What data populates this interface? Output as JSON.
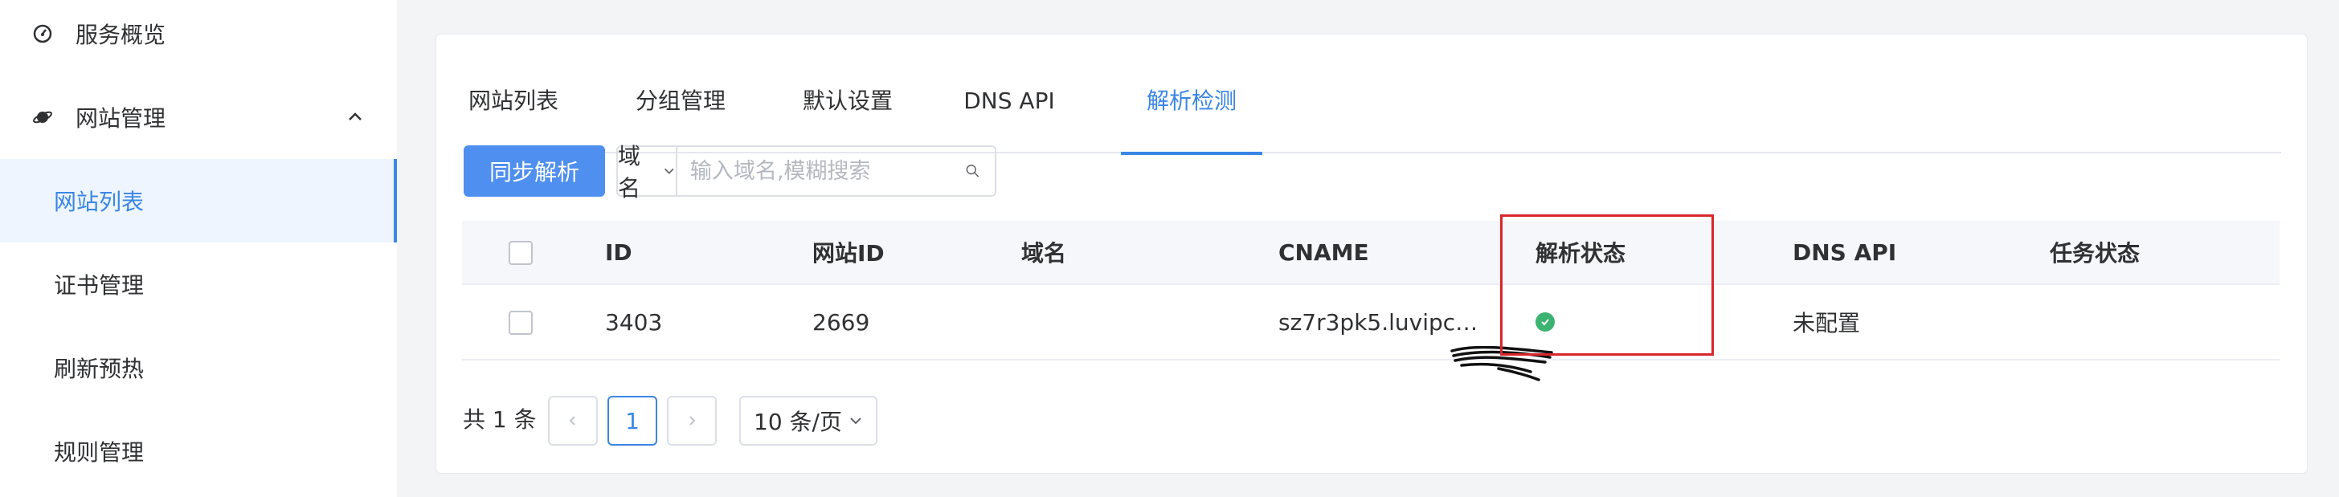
{
  "sidebar": {
    "items": [
      {
        "label": "服务概览",
        "icon": "dashboard-icon"
      },
      {
        "label": "网站管理",
        "icon": "planet-icon"
      },
      {
        "label": "网站列表"
      },
      {
        "label": "证书管理"
      },
      {
        "label": "刷新预热"
      },
      {
        "label": "规则管理"
      }
    ]
  },
  "tabs": [
    {
      "label": "网站列表"
    },
    {
      "label": "分组管理"
    },
    {
      "label": "默认设置"
    },
    {
      "label": "DNS API"
    },
    {
      "label": "解析检测"
    }
  ],
  "toolbar": {
    "sync_label": "同步解析",
    "search_field": "域名",
    "search_placeholder": "输入域名,模糊搜索"
  },
  "table": {
    "headers": [
      "ID",
      "网站ID",
      "域名",
      "CNAME",
      "解析状态",
      "DNS API",
      "任务状态"
    ],
    "rows": [
      {
        "id": "3403",
        "site_id": "2669",
        "domain": "",
        "cname": "sz7r3pk5.luvipc…",
        "status": "ok",
        "dns_api": "未配置",
        "task_status": ""
      }
    ]
  },
  "pagination": {
    "total": "共 1 条",
    "current": "1",
    "page_size": "10 条/页"
  },
  "colors": {
    "accent": "#3a86e6",
    "primary_button": "#4f8fef",
    "success": "#3cb371",
    "highlight": "#d9262c"
  }
}
